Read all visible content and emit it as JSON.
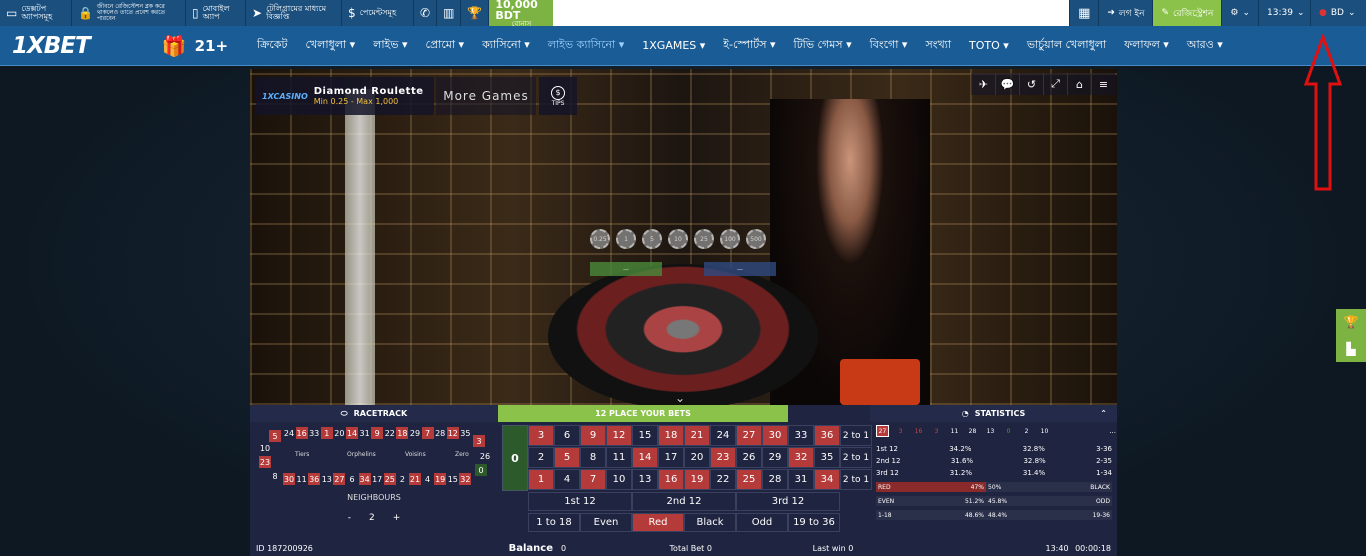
{
  "topbar": {
    "desktop": "ডেক্সটপ অ্যাপসমূহ",
    "lock": "জীবনে রেজিস্টেশন ব্লক করে থাকলেও তাতে প্রবেশ করতে পারবেন",
    "mobile": "মোবাইল অ্যাপ",
    "telegram": "টেলিগ্রামের মাধ্যমে বিজ্ঞপ্তি",
    "payments": "পেমেন্টসমূহ",
    "bonus_amount": "10,000 BDT",
    "bonus_label": "বোনাস",
    "login": "লগ ইন",
    "register": "রেজিস্ট্রেশন",
    "time": "13:39",
    "lang": "BD"
  },
  "nav": {
    "logo": "1XBET",
    "age": "21+",
    "items": [
      "ক্রিকেট",
      "খেলাধুলা ▾",
      "লাইভ ▾",
      "প্রোমো ▾",
      "ক্যাসিনো ▾",
      "লাইভ ক্যাসিনো ▾",
      "1XGAMES ▾",
      "ই-স্পোর্টস ▾",
      "টিভি গেমস ▾",
      "বিংগো ▾",
      "সংখ্যা",
      "TOTO ▾",
      "ভার্চুয়াল খেলাধুলা",
      "ফলাফল ▾",
      "আরও ▾"
    ]
  },
  "game": {
    "casino_brand": "1XCASINO",
    "name": "Diamond Roulette",
    "limits": "Min 0.25 - Max 1,000",
    "more_games": "More Games",
    "tips": "TIPS",
    "chips": [
      "0.25",
      "1",
      "5",
      "10",
      "25",
      "100",
      "500"
    ]
  },
  "panel": {
    "racetrack": "RACETRACK",
    "place_bets": "12 PLACE YOUR BETS",
    "statistics": "STATISTICS",
    "race_numbers": [
      "24",
      "16",
      "33",
      "1",
      "20",
      "14",
      "31",
      "9",
      "22",
      "18",
      "29",
      "7",
      "28",
      "12",
      "35"
    ],
    "race_numbers_bottom": [
      "30",
      "11",
      "36",
      "13",
      "27",
      "6",
      "34",
      "17",
      "25",
      "2",
      "21",
      "4",
      "19",
      "15",
      "32"
    ],
    "race_labels": [
      "Tiers",
      "Orphelins",
      "Voisins",
      "Zero"
    ],
    "race_side": [
      "5",
      "10",
      "23",
      "8",
      "3",
      "26",
      "0"
    ],
    "neighbours": "NEIGHBOURS",
    "nb_minus": "-",
    "nb_value": "2",
    "nb_plus": "+",
    "zero": "0",
    "row3": [
      "3",
      "6",
      "9",
      "12",
      "15",
      "18",
      "21",
      "24",
      "27",
      "30",
      "33",
      "36"
    ],
    "row2": [
      "2",
      "5",
      "8",
      "11",
      "14",
      "17",
      "20",
      "23",
      "26",
      "29",
      "32",
      "35"
    ],
    "row1": [
      "1",
      "4",
      "7",
      "10",
      "13",
      "16",
      "19",
      "22",
      "25",
      "28",
      "31",
      "34"
    ],
    "col": "2 to 1",
    "dozens": [
      "1st 12",
      "2nd 12",
      "3rd 12"
    ],
    "outside": [
      "1 to 18",
      "Even",
      "Red",
      "Black",
      "Odd",
      "19 to 36"
    ],
    "hot_numbers": [
      "27",
      "3",
      "16",
      "3",
      "11",
      "28",
      "13",
      "0",
      "2",
      "10"
    ],
    "more": "...",
    "stat_rows": [
      {
        "l": "1st 12",
        "lv": "34.2%",
        "rv": "32.8%",
        "r": "3-36"
      },
      {
        "l": "2nd 12",
        "lv": "31.6%",
        "rv": "32.8%",
        "r": "2-35"
      },
      {
        "l": "3rd 12",
        "lv": "31.2%",
        "rv": "31.4%",
        "r": "1-34"
      }
    ],
    "red_label": "RED",
    "red_pct": "47%",
    "black_pct": "50%",
    "black_label": "BLACK",
    "even_label": "EVEN",
    "even_pct": "51.2%",
    "odd_pct": "45.8%",
    "odd_label": "ODD",
    "low_label": "1-18",
    "low_pct": "48.6%",
    "high_pct": "48.4%",
    "high_label": "19-36",
    "id": "ID 187200926",
    "balance_label": "Balance",
    "balance": "0",
    "total_bet": "Total Bet 0",
    "last_win": "Last win 0",
    "clock": "13:40",
    "timer": "00:00:18"
  },
  "colors": {
    "accent": "#1a5c96",
    "green": "#7cb342",
    "red": "#b53a3a"
  }
}
